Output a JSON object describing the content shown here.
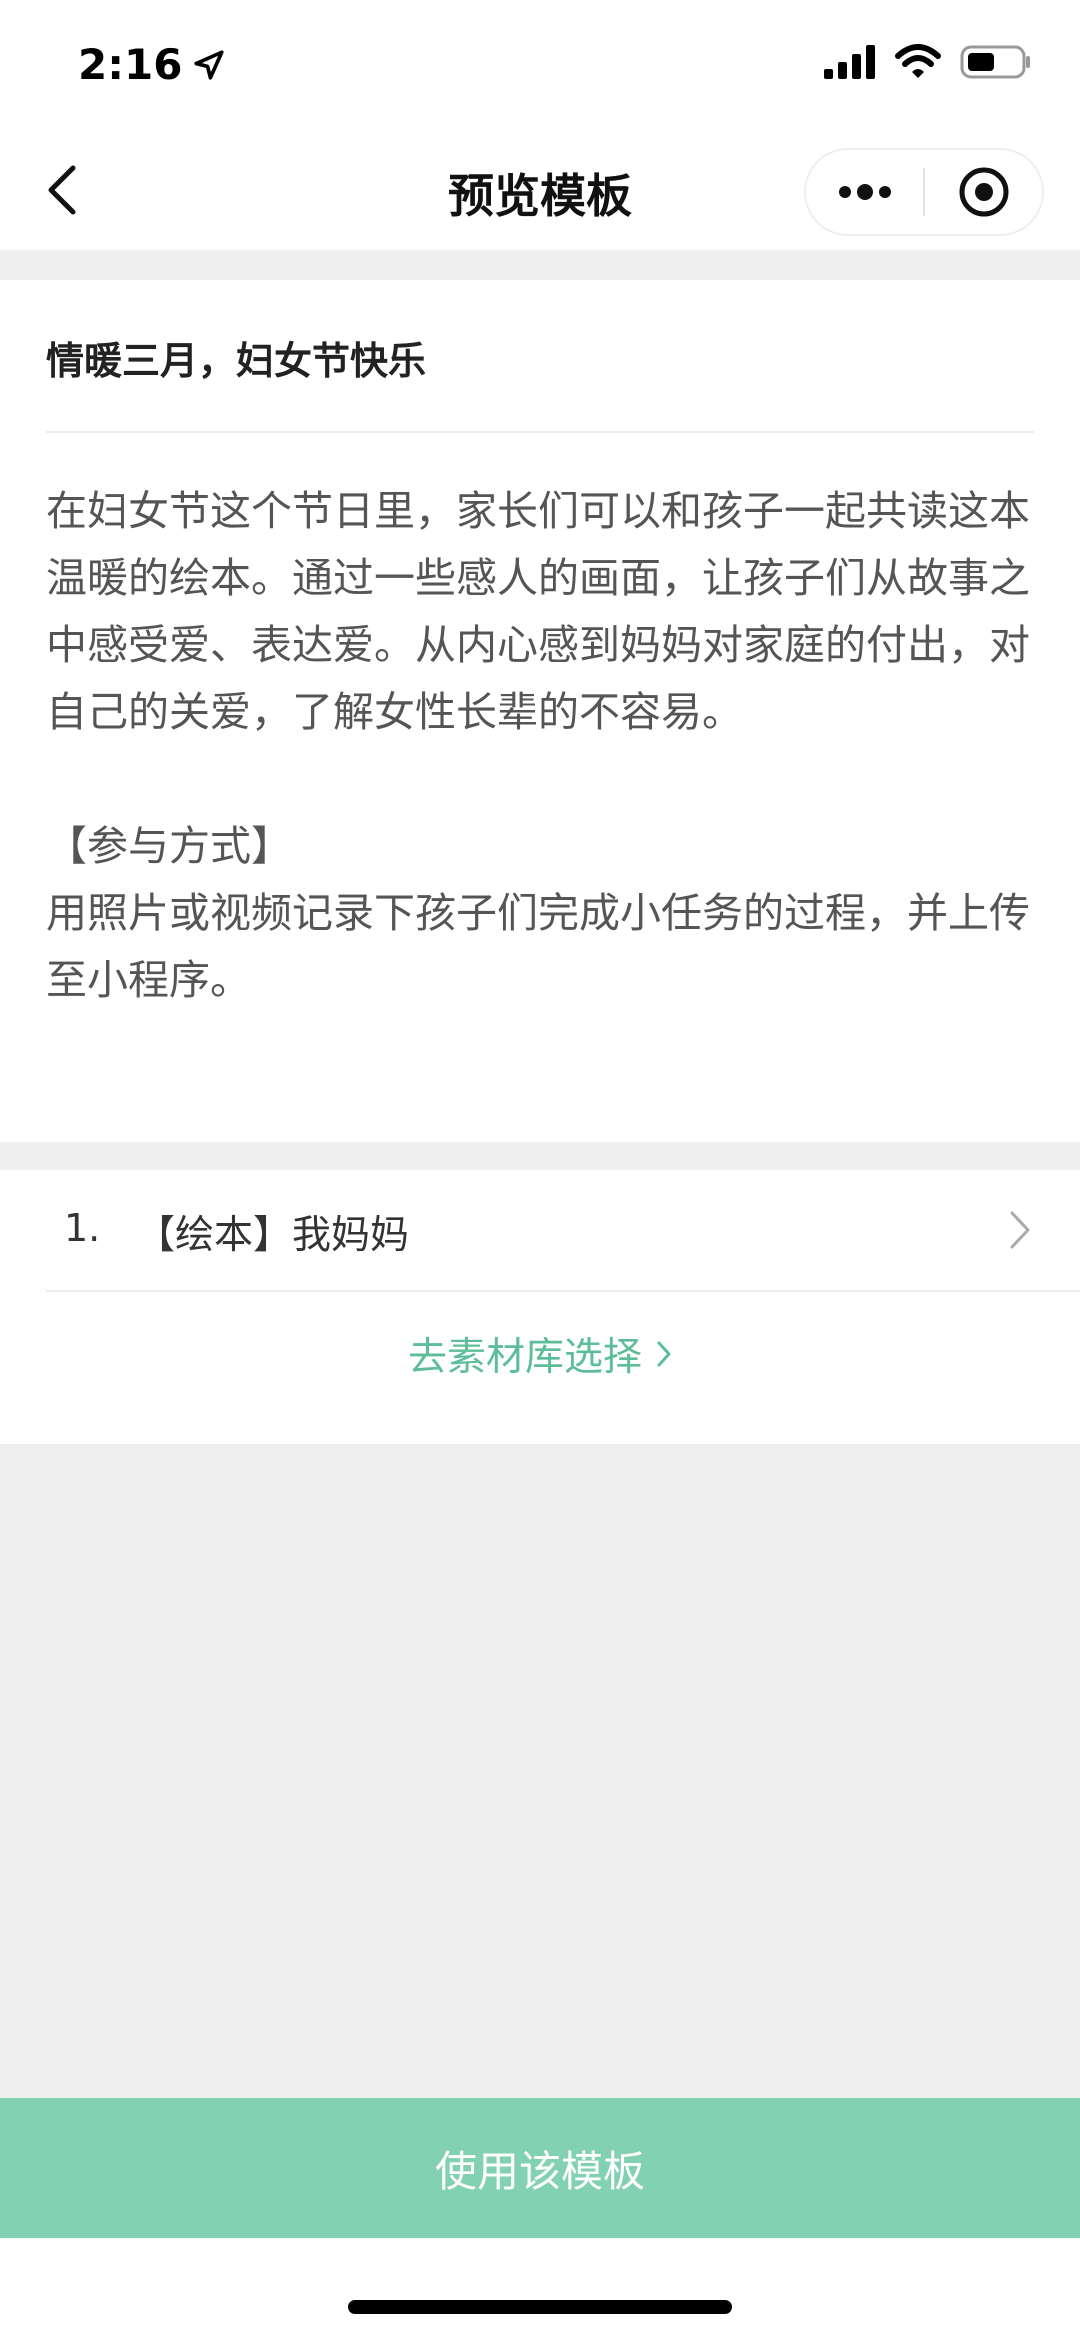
{
  "status_bar": {
    "time": "2:16"
  },
  "nav": {
    "title": "预览模板"
  },
  "template": {
    "title": "情暖三月，妇女节快乐",
    "paragraph_1": "在妇女节这个节日里，家长们可以和孩子一起共读这本温暖的绘本。通过一些感人的画面，让孩子们从故事之中感受爱、表达爱。从内心感到妈妈对家庭的付出，对自己的关爱，了解女性长辈的不容易。",
    "section_heading": "【参与方式】",
    "paragraph_2": "用照片或视频记录下孩子们完成小任务的过程，并上传至小程序。"
  },
  "materials": {
    "items": [
      {
        "number": "1.",
        "label": "【绘本】我妈妈"
      }
    ],
    "library_link": "去素材库选择"
  },
  "action": {
    "use_button": "使用该模板"
  },
  "colors": {
    "accent": "#5cbd98",
    "button": "#82d1b3",
    "background": "#efefef"
  }
}
